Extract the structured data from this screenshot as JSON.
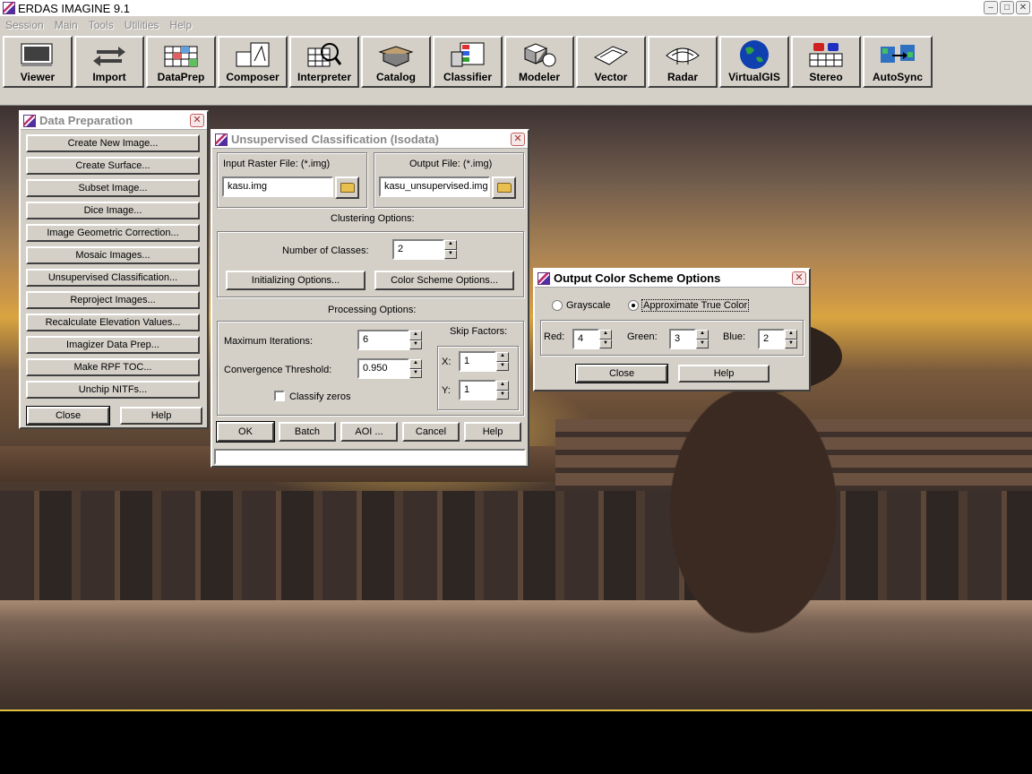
{
  "app": {
    "title": "ERDAS IMAGINE 9.1",
    "menu": [
      "Session",
      "Main",
      "Tools",
      "Utilities",
      "Help"
    ],
    "toolbar": [
      {
        "label": "Viewer",
        "icon": "viewer-icon"
      },
      {
        "label": "Import",
        "icon": "import-arrows-icon"
      },
      {
        "label": "DataPrep",
        "icon": "dataprep-icon"
      },
      {
        "label": "Composer",
        "icon": "composer-icon"
      },
      {
        "label": "Interpreter",
        "icon": "interpreter-icon"
      },
      {
        "label": "Catalog",
        "icon": "catalog-icon"
      },
      {
        "label": "Classifier",
        "icon": "classifier-icon"
      },
      {
        "label": "Modeler",
        "icon": "modeler-icon"
      },
      {
        "label": "Vector",
        "icon": "vector-icon"
      },
      {
        "label": "Radar",
        "icon": "radar-icon"
      },
      {
        "label": "VirtualGIS",
        "icon": "globe-icon"
      },
      {
        "label": "Stereo",
        "icon": "stereo-glasses-icon"
      },
      {
        "label": "AutoSync",
        "icon": "autosync-icon"
      }
    ]
  },
  "dataprep": {
    "title": "Data Preparation",
    "buttons": [
      "Create New Image...",
      "Create Surface...",
      "Subset Image...",
      "Dice Image...",
      "Image Geometric Correction...",
      "Mosaic Images...",
      "Unsupervised Classification...",
      "Reproject Images...",
      "Recalculate Elevation Values...",
      "Imagizer Data Prep...",
      "Make RPF TOC...",
      "Unchip NITFs..."
    ],
    "close": "Close",
    "help": "Help"
  },
  "unsup": {
    "title": "Unsupervised Classification (Isodata)",
    "input_label": "Input Raster File: (*.img)",
    "input_value": "kasu.img",
    "output_label": "Output File: (*.img)",
    "output_value": "kasu_unsupervised.img",
    "clustering_label": "Clustering Options:",
    "num_classes_label": "Number of Classes:",
    "num_classes_value": "2",
    "init_button": "Initializing Options...",
    "color_button": "Color Scheme Options...",
    "processing_label": "Processing Options:",
    "max_iter_label": "Maximum Iterations:",
    "max_iter_value": "6",
    "conv_label": "Convergence Threshold:",
    "conv_value": "0.950",
    "classify_zeros_label": "Classify zeros",
    "skip_label": "Skip Factors:",
    "skip_x_label": "X:",
    "skip_x_value": "1",
    "skip_y_label": "Y:",
    "skip_y_value": "1",
    "ok": "OK",
    "batch": "Batch",
    "aoi": "AOI ...",
    "cancel": "Cancel",
    "help": "Help"
  },
  "colorscheme": {
    "title": "Output Color Scheme Options",
    "grayscale": "Grayscale",
    "approx": "Approximate True Color",
    "red_label": "Red:",
    "red_value": "4",
    "green_label": "Green:",
    "green_value": "3",
    "blue_label": "Blue:",
    "blue_value": "2",
    "close": "Close",
    "help": "Help"
  }
}
